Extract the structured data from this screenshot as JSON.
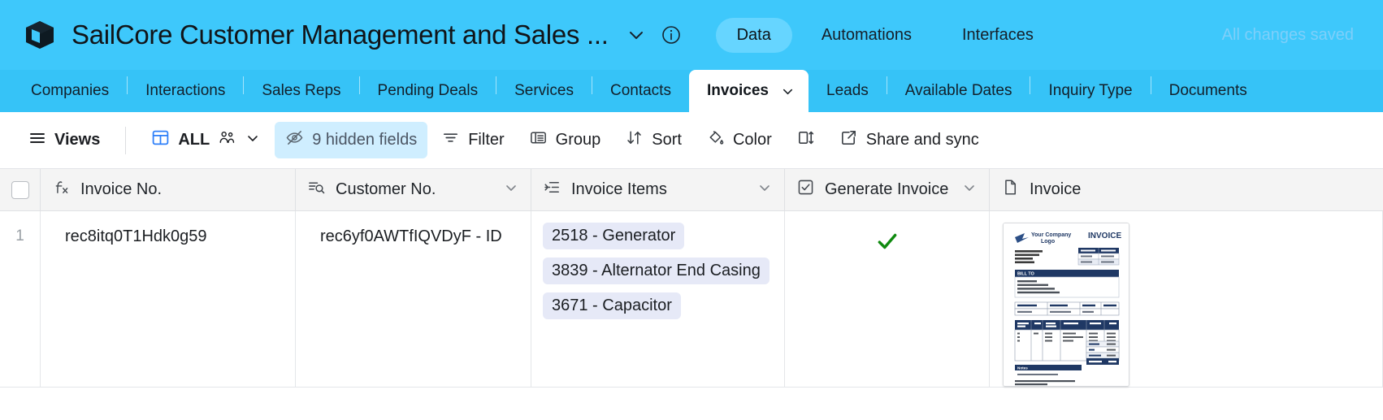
{
  "header": {
    "app_icon": "cube-icon",
    "title": "SailCore Customer Management and Sales ...",
    "title_chevron_icon": "chevron-down-icon",
    "info_icon": "info-circle-icon",
    "tabs": [
      {
        "label": "Data",
        "active": true
      },
      {
        "label": "Automations",
        "active": false
      },
      {
        "label": "Interfaces",
        "active": false
      }
    ],
    "save_status": "All changes saved",
    "colors": {
      "header_bg": "#3ec8fb",
      "tabstrip_bg": "#36c3f7",
      "active_pill": "#66d5ff",
      "save_status_text": "#7ecffa"
    }
  },
  "table_tabs": [
    {
      "label": "Companies",
      "active": false
    },
    {
      "label": "Interactions",
      "active": false
    },
    {
      "label": "Sales Reps",
      "active": false
    },
    {
      "label": "Pending Deals",
      "active": false
    },
    {
      "label": "Services",
      "active": false
    },
    {
      "label": "Contacts",
      "active": false
    },
    {
      "label": "Invoices",
      "active": true
    },
    {
      "label": "Leads",
      "active": false
    },
    {
      "label": "Available Dates",
      "active": false
    },
    {
      "label": "Inquiry Type",
      "active": false
    },
    {
      "label": "Documents",
      "active": false
    }
  ],
  "toolbar": {
    "views_label": "Views",
    "views_icon": "hamburger-icon",
    "view_name": "ALL",
    "view_grid_icon": "grid-table-icon",
    "collaborators_icon": "people-icon",
    "view_chevron_icon": "chevron-down-icon",
    "hidden_fields_label": "9 hidden fields",
    "hidden_fields_icon": "eye-off-icon",
    "filter_label": "Filter",
    "filter_icon": "filter-icon",
    "group_label": "Group",
    "group_icon": "group-rows-icon",
    "sort_label": "Sort",
    "sort_icon": "sort-arrows-icon",
    "color_label": "Color",
    "color_icon": "paint-bucket-icon",
    "row_height_icon": "row-height-icon",
    "share_label": "Share and sync",
    "share_icon": "share-external-icon",
    "hidden_fields_bg": "#cfeeff"
  },
  "grid": {
    "columns": [
      {
        "name": "Invoice No.",
        "type_icon": "formula-fx-icon",
        "has_menu": true
      },
      {
        "name": "Customer No.",
        "type_icon": "lookup-search-icon",
        "has_menu": true
      },
      {
        "name": "Invoice Items",
        "type_icon": "linked-records-icon",
        "has_menu": true
      },
      {
        "name": "Generate Invoice",
        "type_icon": "checkbox-icon",
        "has_menu": true
      },
      {
        "name": "Invoice",
        "type_icon": "attachment-file-icon",
        "has_menu": false
      }
    ],
    "rows": [
      {
        "number": "1",
        "invoice_no": "rec8itq0T1Hdk0g59",
        "customer_no": "rec6yf0AWTfIQVDyF - ID",
        "invoice_items": [
          "2518 - Generator",
          "3839 - Alternator End Casing",
          "3671 - Capacitor"
        ],
        "generate_invoice": true,
        "generate_invoice_icon": "green-check-icon",
        "attachment": "invoice-thumbnail"
      }
    ],
    "check_color": "#1a8f1a",
    "chip_bg": "#e6e9f7"
  },
  "invoice_preview": {
    "company_logo_text": "Your Company Logo",
    "address_lines": [
      "Your Address",
      "City, State Zip",
      "Phone",
      "Website"
    ],
    "bill_to_heading": "BILL TO",
    "bill_to_lines": [
      "Nucleoson",
      "2508 Porter Blvd",
      "Salt Lake City, Utah 98401",
      "example@sparkboard.com"
    ],
    "table1_headers": [
      "P.O. Number",
      "Ship Date",
      "Ship Via",
      "Total Weight"
    ],
    "table1_values": [
      "000001",
      "2021-09-24",
      "FedEx",
      ""
    ],
    "items_headers": [
      "Quantity",
      "Unit",
      "Item Number",
      "Description",
      "Unit Price",
      "Total"
    ],
    "items_rows": [
      {
        "qty": "1",
        "unit": "EA",
        "item": "2518",
        "desc": "Generator",
        "price": "",
        "total": ""
      },
      {
        "qty": "1",
        "unit": "",
        "item": "3839",
        "desc": "Alternator End Casing",
        "price": "",
        "total": ""
      },
      {
        "qty": "1",
        "unit": "",
        "item": "3671",
        "desc": "Capacitor",
        "price": "",
        "total": ""
      }
    ],
    "totals_labels": [
      "SUBTOTAL",
      "TAX",
      "SHIPPING",
      "TOTAL DUE"
    ],
    "notes_heading": "Notes",
    "notes_text": "Will add capacitor to next order",
    "footer_text": "Thank you for your order! Please remit payment to:",
    "footer_lines": [
      "Your Company Name",
      "Address",
      "City, State Zip"
    ],
    "title": "INVOICE",
    "accent": "#1f3864"
  }
}
